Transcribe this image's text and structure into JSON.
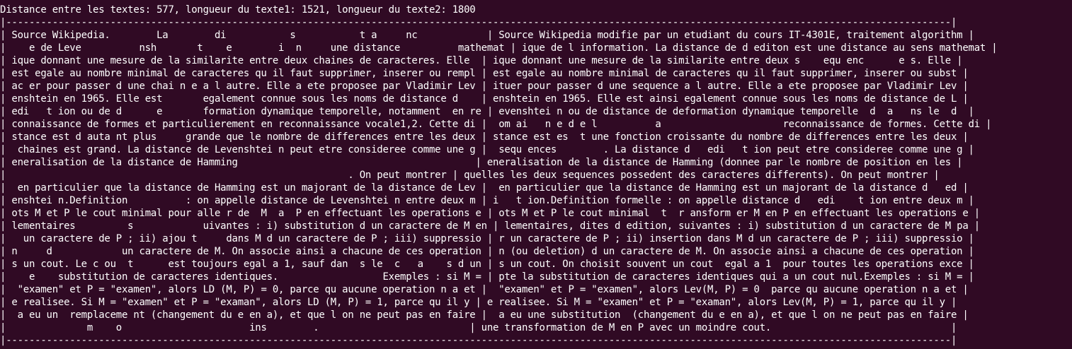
{
  "terminal": {
    "theme": {
      "background": "#300a24",
      "foreground": "#ffffff"
    },
    "lines": [
      "Distance entre les textes: 577, longueur du texte1: 1521, longueur du texte2: 1800",
      "|-------------------------------------------------------------------------------------------------------------------------------------------------------------------|",
      "| Source Wikipedia.        La        di           s           t a     nc            | Source Wikipedia modifie par un etudiant du cours IT-4301E, traitement algorithm |",
      "|    e de Leve          nsh       t    e        i  n     une distance          mathemat | ique de l information. La distance de d editon est une distance au sens mathemat |",
      "| ique donnant une mesure de la similarite entre deux chaines de caracteres. Elle  | ique donnant une mesure de la similarite entre deux s    equ enc      e s. Elle |",
      "| est egale au nombre minimal de caracteres qu il faut supprimer, inserer ou rempl | est egale au nombre minimal de caracteres qu il faut supprimer, inserer ou subst |",
      "| ac er pour passer d une chai n e a l autre. Elle a ete proposee par Vladimir Lev | ituer pour passer d une sequence a l autre. Elle a ete proposee par Vladimir Lev |",
      "| enshtein en 1965. Elle est       egalement connue sous les noms de distance d    | enshtein en 1965. Elle est ainsi egalement connue sous les noms de distance de L |",
      "| edi   t ion ou de d      e       formation dynamique temporelle, notamment  en re | evenshtei n ou de distance de deformation dynamique temporelle  d  a   ns le  d  |",
      "| connaissance de formes et particulierement en reconnaissance vocale1,2. Cette di |  om ai   n e d e l          a                     reconnaissance de formes. Cette di |",
      "| stance est d auta nt plus     grande que le nombre de differences entre les deux | stance est es  t une fonction croissante du nombre de differences entre les deux |",
      "|  chaines est grand. La distance de Levenshtei n peut etre consideree comme une g |  sequ ences        . La distance d   edi   t ion peut etre consideree comme une g |",
      "| eneralisation de la distance de Hamming                                         | eneralisation de la distance de Hamming (donnee par le nombre de position en les |",
      "|                                                           . On peut montrer | quelles les deux sequences possedent des caracteres differents). On peut montrer |",
      "|  en particulier que la distance de Hamming est un majorant de la distance de Lev |  en particulier que la distance de Hamming est un majorant de la distance d   ed |",
      "| enshtei n.Definition          : on appelle distance de Levenshtei n entre deux m | i   t ion.Definition formelle : on appelle distance d   edi    t ion entre deux m |",
      "| ots M et P le cout minimal pour alle r de  M  a  P en effectuant les operations e | ots M et P le cout minimal  t  r ansform er M en P en effectuant les operations e |",
      "| lementaires         s            uivantes : i) substitution d un caractere de M en | lementaires, dites d edition, suivantes : i) substitution d un caractere de M pa |",
      "|   un caractere de P ; ii) ajou t     dans M d un caractere de P ; iii) suppressio | r un caractere de P ; ii) insertion dans M d un caractere de P ; iii) suppressio |",
      "| n     d            un caractere de M. On associe ainsi a chacune de ces operation | n (ou deletion) d un caractere de M. On associe ainsi a chacune de ces operation |",
      "| s un cout. Le c ou  t      est toujours egal a 1, sauf dan  s le  c   a    s d un | s un cout. On choisit souvent un cout  egal a 1  pour toutes les operations exce |",
      "|    e    substitution de caracteres identiques.                  Exemples : si M = | pte la substitution de caracteres identiques qui a un cout nul.Exemples : si M = |",
      "|  \"examen\" et P = \"examen\", alors LD (M, P) = 0, parce qu aucune operation n a et |  \"examen\" et P = \"examen\", alors Lev(M, P) = 0  parce qu aucune operation n a et |",
      "| e realisee. Si M = \"examen\" et P = \"examan\", alors LD (M, P) = 1, parce qu il y | e realisee. Si M = \"examen\" et P = \"examan\", alors Lev(M, P) = 1, parce qu il y |",
      "|  a eu un  remplaceme nt (changement du e en a), et que l on ne peut pas en faire |  a eu une substitution  (changement du e en a), et que l on ne peut pas en faire |",
      "|              m    o                      ins        .                          | une transformation de M en P avec un moindre cout.                               |",
      "|-------------------------------------------------------------------------------------------------------------------------------------------------------------------|"
    ]
  }
}
